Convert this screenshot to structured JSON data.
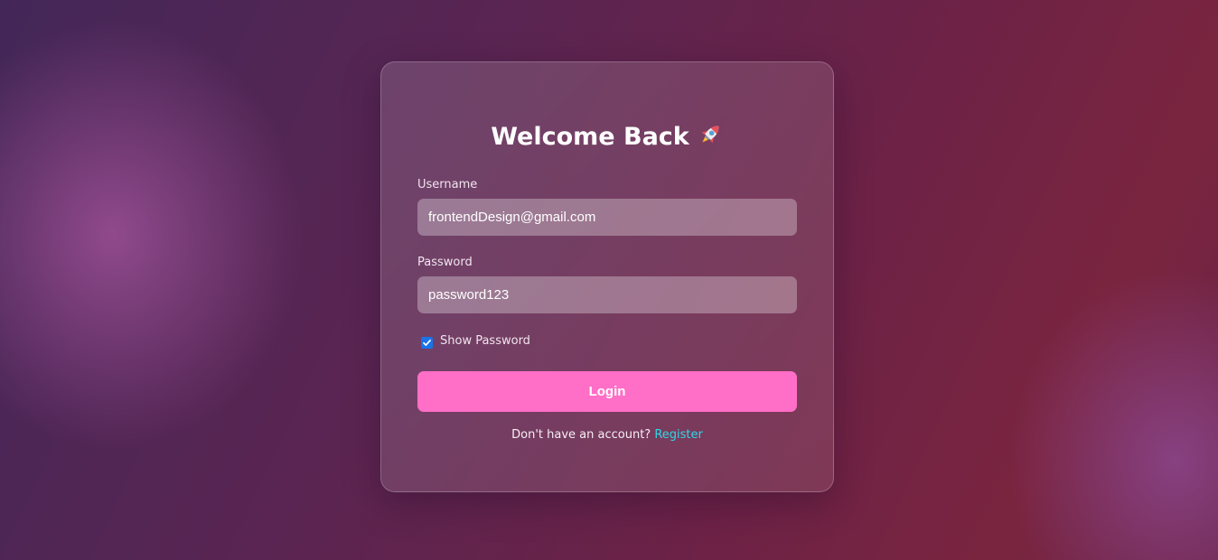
{
  "login_card": {
    "title": "Welcome Back",
    "title_icon": "rocket-icon",
    "username": {
      "label": "Username",
      "value": "frontendDesign@gmail.com"
    },
    "password": {
      "label": "Password",
      "value": "password123"
    },
    "show_password": {
      "label": "Show Password",
      "checked": true
    },
    "login_button": "Login",
    "footer": {
      "prompt": "Don't have an account?",
      "link": "Register"
    }
  },
  "colors": {
    "accent_button": "#ff6ec7",
    "link": "#2fd7e6",
    "checkbox": "#1a73e8"
  }
}
